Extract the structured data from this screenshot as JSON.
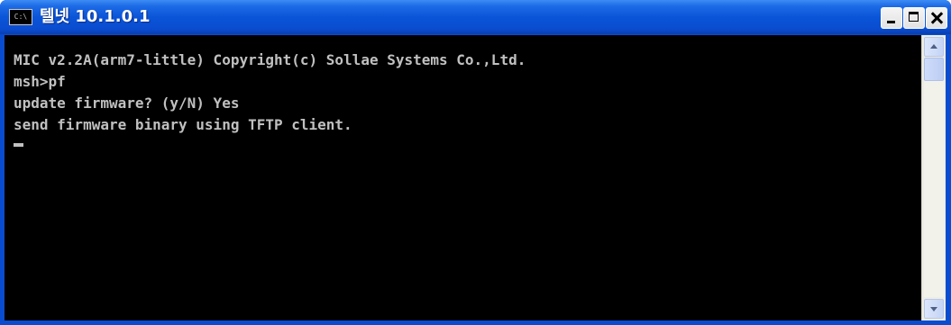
{
  "window": {
    "icon_text": "C:\\",
    "title": "텔넷 10.1.0.1"
  },
  "controls": {
    "minimize": "minimize",
    "maximize": "maximize",
    "close": "close"
  },
  "console": {
    "lines": [
      "MIC v2.2A(arm7-little) Copyright(c) Sollae Systems Co.,Ltd.",
      "msh>pf",
      "update firmware? (y/N) Yes",
      "send firmware binary using TFTP client."
    ]
  },
  "colors": {
    "titlebar": "#0a4ccf",
    "console_bg": "#000000",
    "console_text": "#c0c0c0",
    "scrollbar": "#eeede5"
  }
}
